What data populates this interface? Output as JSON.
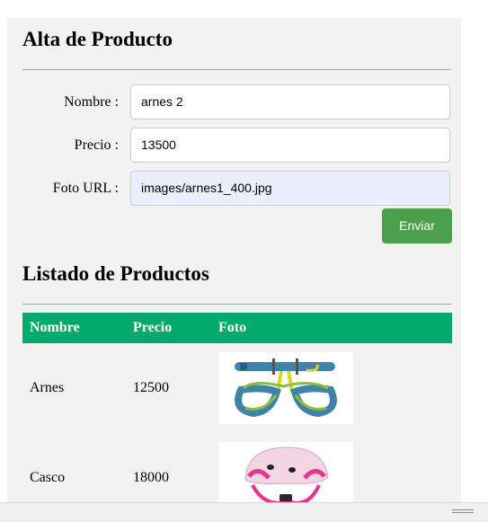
{
  "form": {
    "title": "Alta de Producto",
    "nombre_label": "Nombre :",
    "nombre_value": "arnes 2",
    "precio_label": "Precio :",
    "precio_value": "13500",
    "foto_label": "Foto URL :",
    "foto_value": "images/arnes1_400.jpg",
    "submit_label": "Enviar"
  },
  "list": {
    "title": "Listado de Productos",
    "columns": [
      "Nombre",
      "Precio",
      "Foto"
    ],
    "rows": [
      {
        "nombre": "Arnes",
        "precio": "12500",
        "foto": "harness-image"
      },
      {
        "nombre": "Casco",
        "precio": "18000",
        "foto": "helmet-image"
      }
    ]
  },
  "colors": {
    "header_bg": "#04aa6d",
    "submit_bg": "#4ca04c",
    "autofill_bg": "#e8f0fe"
  }
}
